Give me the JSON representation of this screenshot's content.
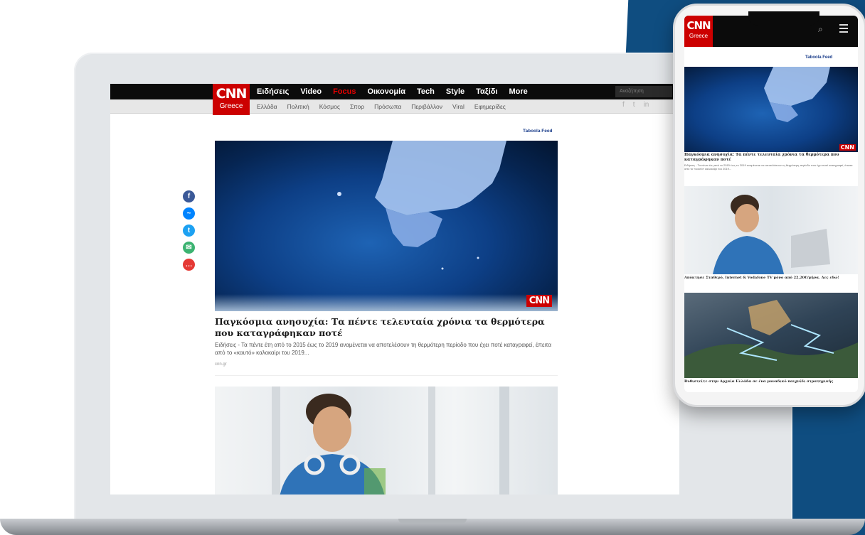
{
  "site": {
    "logo_top": "CNN",
    "logo_bottom": "Greece",
    "nav": [
      "Ειδήσεις",
      "Video",
      "Focus",
      "Οικονομία",
      "Tech",
      "Style",
      "Ταξίδι",
      "More"
    ],
    "active_nav": "Focus",
    "subnav": [
      "Ελλάδα",
      "Πολιτική",
      "Κόσμος",
      "Σπορ",
      "Πρόσωπα",
      "Περιβάλλον",
      "Viral",
      "Εφημερίδες"
    ],
    "search_placeholder": "Αναζήτηση",
    "social_top": [
      "f",
      "t",
      "in"
    ]
  },
  "feed": {
    "widget_label": "Taboola Feed",
    "hero_logo": "CNN",
    "article_title": "Παγκόσμια ανησυχία: Τα πέντε τελευταία χρόνια τα θερμότερα που καταγράφηκαν ποτέ",
    "article_desc": "Ειδήσεις - Τα πέντε έτη από το 2015 έως το 2019 αναμένεται να αποτελέσουν τη θερμότερη περίοδο που έχει ποτέ καταγραφεί, έπειτα από το «καυτό» καλοκαίρι του 2019...",
    "article_source": "cnn.gr"
  },
  "share": [
    {
      "name": "facebook-icon",
      "glyph": "f",
      "color": "#3b5998"
    },
    {
      "name": "messenger-icon",
      "glyph": "~",
      "color": "#0084ff"
    },
    {
      "name": "twitter-icon",
      "glyph": "t",
      "color": "#1da1f2"
    },
    {
      "name": "email-icon",
      "glyph": "✉",
      "color": "#3cb371"
    },
    {
      "name": "more-icon",
      "glyph": "…",
      "color": "#e53935"
    }
  ],
  "phone": {
    "logo_top": "CNN",
    "logo_bottom": "Greece",
    "widget_label": "Taboola Feed",
    "hero_logo": "CNN",
    "article_title": "Παγκόσμια ανησυχία: Τα πέντε τελευταία χρόνια τα θερμότερα που καταγράφηκαν ποτέ",
    "article_desc": "Ειδήσεις - Τα πέντε έτη από το 2015 έως το 2019 αναμένεται να αποτελέσουν τη θερμότερη περίοδο που έχει ποτέ καταγραφεί, έπειτα από το «καυτό» καλοκαίρι του 2019...",
    "article_source": "cnn.gr",
    "ad_title": "Απόκτησε Σταθερό, Internet & Vodafone TV μόνο από 22,20€/μήνα. Δες εδώ!",
    "game_title": "Βυθιστείτε στην Αρχαία Ελλάδα σε ένα μοναδικό παιχνίδι στρατηγικής"
  },
  "colors": {
    "brand_red": "#cc0000",
    "bg_blue": "#0f4d80",
    "topbar": "#0b0b0b"
  }
}
